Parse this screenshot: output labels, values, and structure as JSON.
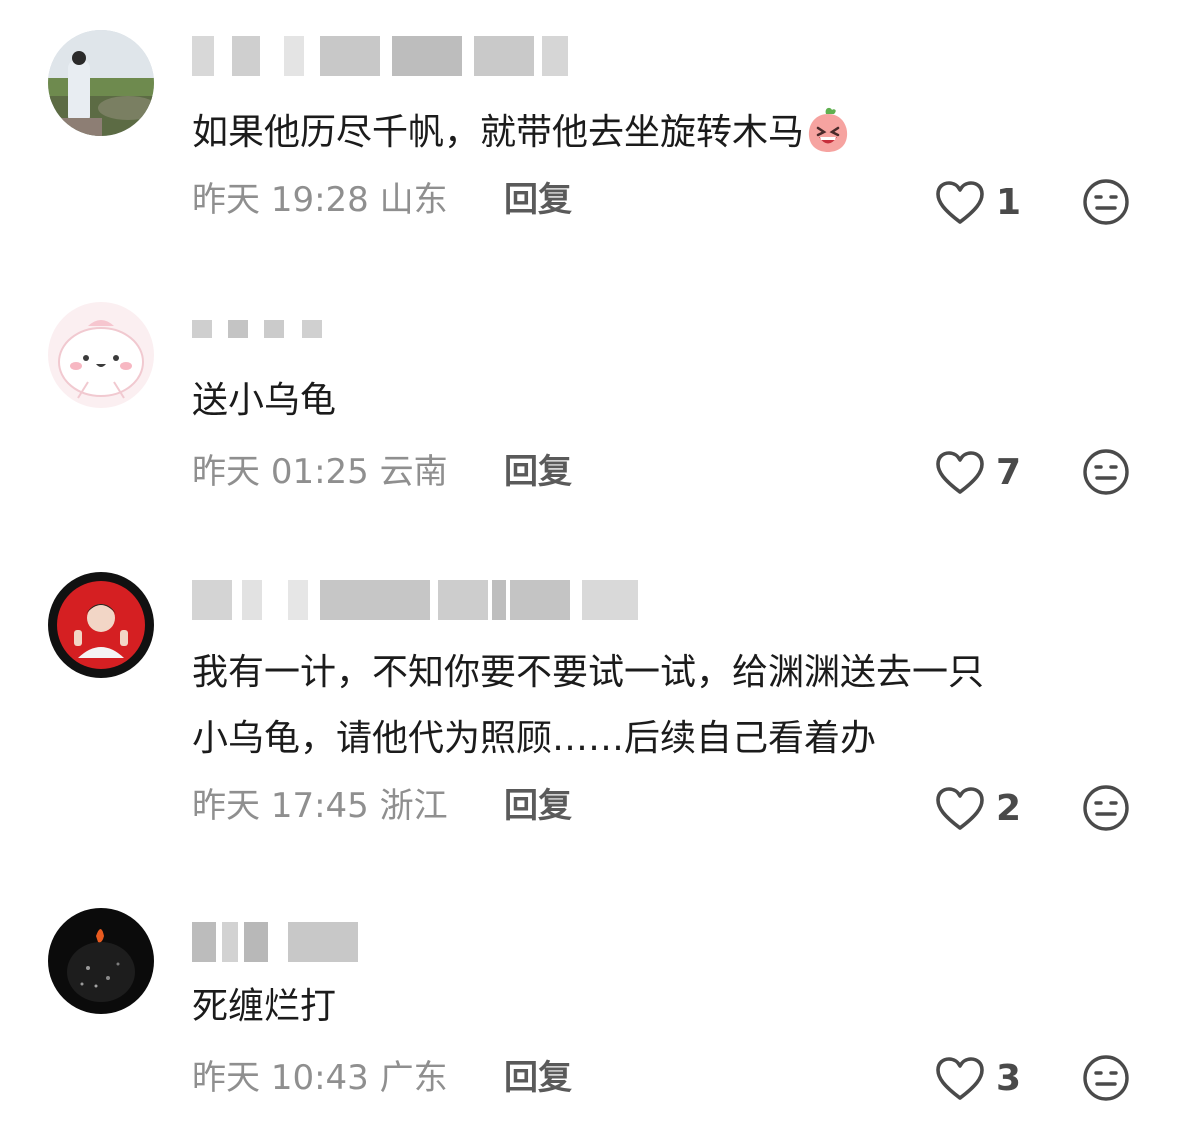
{
  "comments": [
    {
      "text": "如果他历尽千帆，就带他去坐旋转木马",
      "emoji": "laughing-peach-emoji",
      "date": "昨天",
      "time": "19:28",
      "location": "山东",
      "reply_label": "回复",
      "likes": "1"
    },
    {
      "text": "送小乌龟",
      "date": "昨天",
      "time": "01:25",
      "location": "云南",
      "reply_label": "回复",
      "likes": "7"
    },
    {
      "text_line1": "我有一计，不知你要不要试一试，给渊渊送去一只",
      "text_line2": "小乌龟，请他代为照顾……后续自己看着办",
      "date": "昨天",
      "time": "17:45",
      "location": "浙江",
      "reply_label": "回复",
      "likes": "2"
    },
    {
      "text": "死缠烂打",
      "date": "昨天",
      "time": "10:43",
      "location": "广东",
      "reply_label": "回复",
      "likes": "3"
    }
  ],
  "icons": {
    "like": "heart-outline-icon",
    "dislike": "neutral-face-icon"
  },
  "colors": {
    "text": "#1b1b1b",
    "meta": "#8f8f8f",
    "icon": "#4a4a4a"
  }
}
